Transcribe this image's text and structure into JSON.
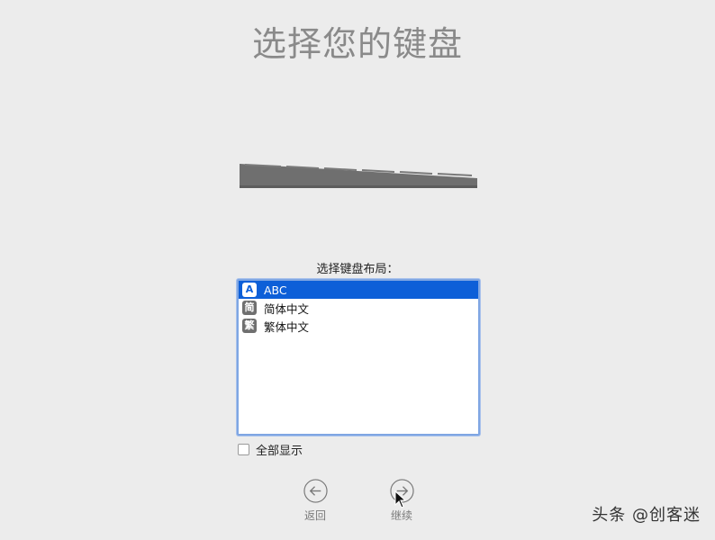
{
  "header": {
    "title": "选择您的键盘"
  },
  "layout_picker": {
    "prompt": "选择键盘布局：",
    "items": [
      {
        "badge": "A",
        "label": "ABC",
        "selected": true
      },
      {
        "badge": "简",
        "label": "简体中文",
        "selected": false
      },
      {
        "badge": "繁",
        "label": "繁体中文",
        "selected": false
      }
    ],
    "show_all_label": "全部显示",
    "show_all_checked": false
  },
  "navigation": {
    "back_label": "返回",
    "continue_label": "继续"
  },
  "watermark": "头条 @创客迷",
  "colors": {
    "background": "#ececec",
    "selection": "#0d5fd8",
    "title": "#8a8a8a",
    "focus_ring": "#7fa6e3"
  },
  "icons": {
    "back": "arrow-left-circle-icon",
    "continue": "arrow-right-circle-icon",
    "cursor": "mouse-pointer-icon"
  }
}
